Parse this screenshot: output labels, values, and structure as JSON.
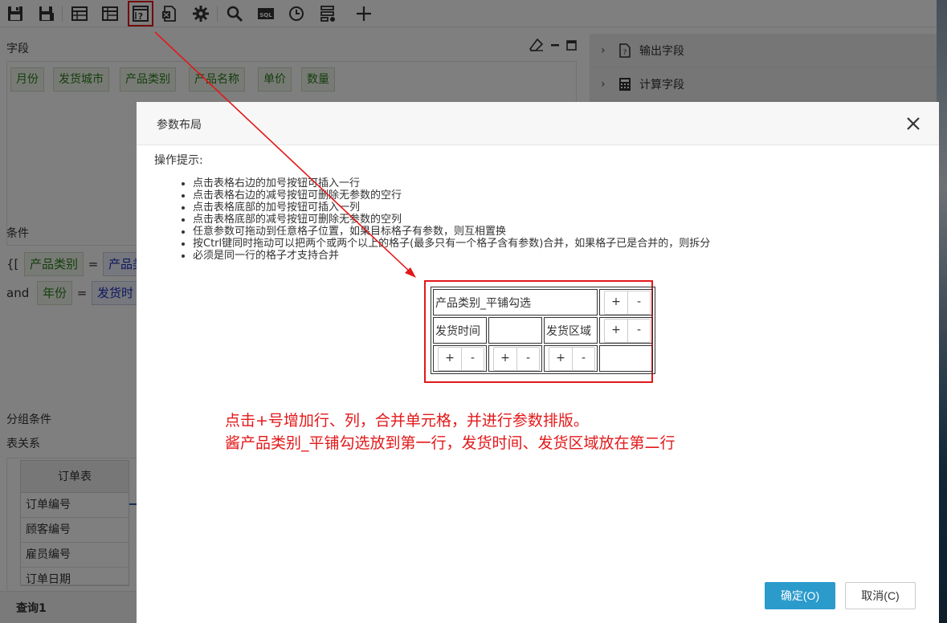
{
  "toolbar": {
    "icons": [
      "save-icon",
      "save-as-icon",
      "table-layout-icon",
      "table-grid-icon",
      "parameter-layout-icon",
      "export-icon",
      "settings-icon",
      "search-icon",
      "sql-icon",
      "history-icon",
      "filter-icon",
      "add-icon"
    ],
    "sql_text": "SQL"
  },
  "fields": {
    "title": "字段",
    "items": [
      "月份",
      "发货城市",
      "产品类别",
      "产品名称",
      "单价",
      "数量"
    ]
  },
  "conditions": {
    "title": "条件",
    "rows": [
      {
        "prefix": "{[",
        "field": "产品类别",
        "op": "=",
        "value": "产品类"
      },
      {
        "prefix": "and",
        "field": "年份",
        "op": "=",
        "value": "发货时"
      }
    ]
  },
  "group_title": "分组条件",
  "relations": {
    "title": "表关系",
    "table_name": "订单表",
    "columns": [
      "订单编号",
      "顾客编号",
      "雇员编号",
      "订单日期"
    ]
  },
  "bottom_tab": "查询1",
  "right_panel": {
    "items": [
      {
        "label": "输出字段",
        "icon": "output-field-icon"
      },
      {
        "label": "计算字段",
        "icon": "calculator-icon"
      }
    ]
  },
  "modal": {
    "title": "参数布局",
    "hint_title": "操作提示:",
    "hints": [
      "点击表格右边的加号按钮可插入一行",
      "点击表格右边的减号按钮可删除无参数的空行",
      "点击表格底部的加号按钮可插入一列",
      "点击表格底部的减号按钮可删除无参数的空列",
      "任意参数可拖动到任意格子位置，如果目标格子有参数，则互相置换",
      "按Ctrl键同时拖动可以把两个或两个以上的格子(最多只有一个格子含有参数)合并，如果格子已是合并的，则拆分",
      "必须是同一行的格子才支持合并"
    ],
    "grid": {
      "row1_cell": "产品类别_平铺勾选",
      "row2_cell1": "发货时间",
      "row2_cell3": "发货区域",
      "plus": "+",
      "minus": "-"
    },
    "annotation_line1": "点击+号增加行、列，合并单元格，并进行参数排版。",
    "annotation_line2": "酱产品类别_平铺勾选放到第一行，发货时间、发货区域放在第二行",
    "ok_label": "确定(O)",
    "cancel_label": "取消(C)"
  },
  "colors": {
    "highlight_red": "#e3181a",
    "primary_blue": "#2b9bcc",
    "field_green": "#2a7a1c",
    "value_blue": "#1b2fbf"
  }
}
